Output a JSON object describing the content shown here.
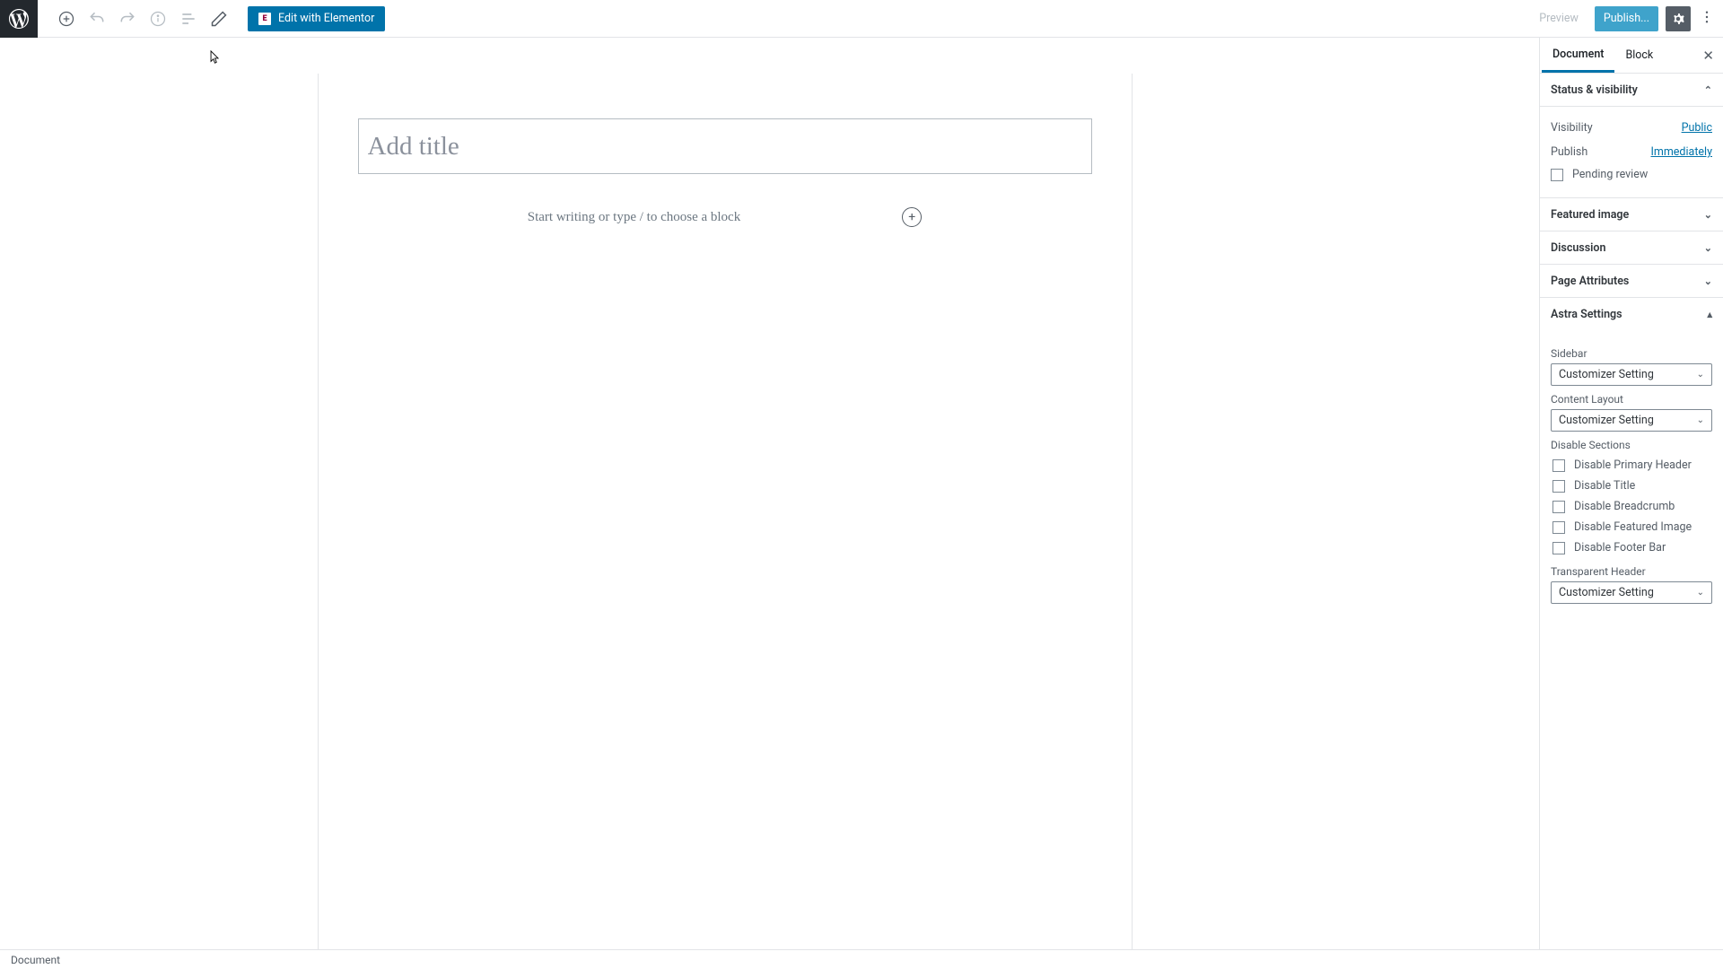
{
  "toolbar": {
    "elementor_label": "Edit with Elementor",
    "preview_label": "Preview",
    "publish_label": "Publish..."
  },
  "editor": {
    "title_placeholder": "Add title",
    "body_placeholder": "Start writing or type / to choose a block"
  },
  "sidebar": {
    "tabs": {
      "document": "Document",
      "block": "Block"
    },
    "status": {
      "title": "Status & visibility",
      "visibility_label": "Visibility",
      "visibility_value": "Public",
      "publish_label": "Publish",
      "publish_value": "Immediately",
      "pending_review": "Pending review"
    },
    "featured_image": "Featured image",
    "discussion": "Discussion",
    "page_attributes": "Page Attributes",
    "astra": {
      "title": "Astra Settings",
      "sidebar_label": "Sidebar",
      "sidebar_value": "Customizer Setting",
      "content_label": "Content Layout",
      "content_value": "Customizer Setting",
      "disable_sections": "Disable Sections",
      "disable_primary": "Disable Primary Header",
      "disable_title": "Disable Title",
      "disable_breadcrumb": "Disable Breadcrumb",
      "disable_featured": "Disable Featured Image",
      "disable_footer": "Disable Footer Bar",
      "transparent_label": "Transparent Header",
      "transparent_value": "Customizer Setting"
    }
  },
  "footer": {
    "breadcrumb": "Document"
  }
}
